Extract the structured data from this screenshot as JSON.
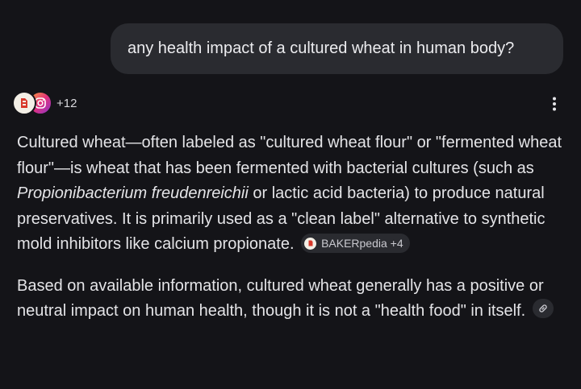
{
  "user_message": "any health impact of a cultured wheat in human body?",
  "sources": {
    "count_label": "+12",
    "icons": [
      "bakerpedia-icon",
      "instagram-icon"
    ]
  },
  "answer": {
    "p1": {
      "before_italic": "Cultured wheat—often labeled as \"cultured wheat flour\" or \"fermented wheat flour\"—is wheat that has been fermented with bacterial cultures (such as ",
      "italic": "Propionibacterium freudenreichii",
      "after_italic": " or lactic acid bacteria) to produce natural preservatives. It is primarily used as a \"clean label\" alternative to synthetic mold inhibitors like calcium propionate.",
      "citation_label": "BAKERpedia +4"
    },
    "p2": {
      "text": "Based on available information, cultured wheat generally has a positive or neutral impact on human health, though it is not a \"health food\" in itself."
    }
  },
  "colors": {
    "background": "#141418",
    "bubble": "#2a2b30",
    "text": "#e4e4e7"
  }
}
